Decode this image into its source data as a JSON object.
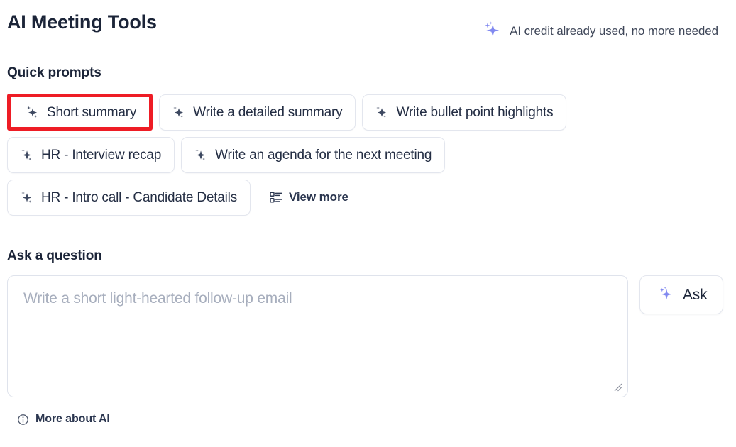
{
  "header": {
    "title": "AI Meeting Tools",
    "credit_icon": "sparkle-icon",
    "credit_text": "AI credit already used, no more needed"
  },
  "quick_prompts": {
    "section_title": "Quick prompts",
    "rows": [
      [
        {
          "label": "Short summary",
          "icon": "sparkle-icon",
          "highlighted": true
        },
        {
          "label": "Write a detailed summary",
          "icon": "sparkle-icon",
          "highlighted": false
        },
        {
          "label": "Write bullet point highlights",
          "icon": "sparkle-icon",
          "highlighted": false
        }
      ],
      [
        {
          "label": "HR - Interview recap",
          "icon": "sparkle-icon",
          "highlighted": false
        },
        {
          "label": "Write an agenda for the next meeting",
          "icon": "sparkle-icon",
          "highlighted": false
        }
      ],
      [
        {
          "label": "HR - Intro call - Candidate Details",
          "icon": "sparkle-icon",
          "highlighted": false
        }
      ]
    ],
    "view_more": {
      "label": "View more",
      "icon": "list-view-icon"
    }
  },
  "ask": {
    "section_title": "Ask a question",
    "input_placeholder": "Write a short light-hearted follow-up email",
    "input_value": "",
    "button_label": "Ask",
    "button_icon": "sparkle-icon",
    "resize_handle_icon": "resize-grip-icon"
  },
  "footer": {
    "label": "More about AI",
    "icon": "info-circle-icon"
  },
  "colors": {
    "accent_sparkle": "#8189f0",
    "text_primary": "#1b2438",
    "text_secondary": "#3f4759",
    "placeholder": "#a7aebd",
    "chip_border": "#e3e6ee",
    "highlight_box": "#ee1c25",
    "background": "#ffffff"
  }
}
